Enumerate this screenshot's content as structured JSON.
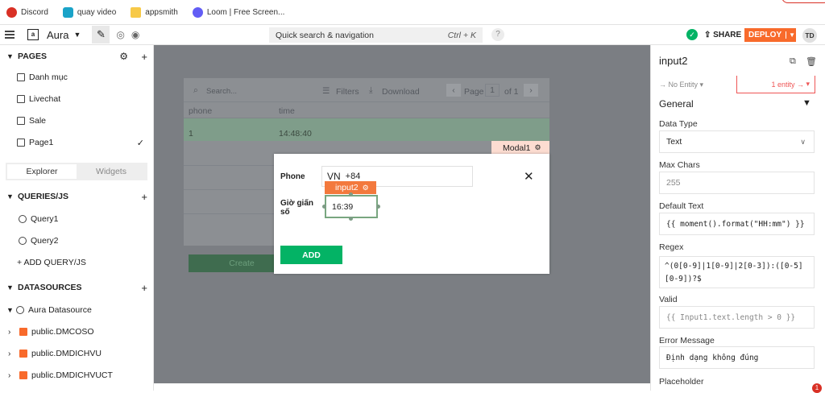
{
  "bookmarks": [
    {
      "label": "Discord",
      "color": "#d93025"
    },
    {
      "label": "quay video",
      "color": "#1aa3c8"
    },
    {
      "label": "appsmith",
      "color": "#f7c948"
    },
    {
      "label": "Loom | Free Screen...",
      "color": "#625df5"
    }
  ],
  "topbar": {
    "app_name": "Aura",
    "search_label": "Quick search & navigation",
    "search_shortcut": "Ctrl + K",
    "help": "?",
    "share": "SHARE",
    "deploy": "DEPLOY",
    "avatar": "TD"
  },
  "sidebar": {
    "pages_title": "PAGES",
    "pages": [
      "Danh mục",
      "Livechat",
      "Sale",
      "Page1"
    ],
    "tabs": [
      "Explorer",
      "Widgets"
    ],
    "queries_title": "QUERIES/JS",
    "queries": [
      "Query1",
      "Query2"
    ],
    "add_query": "+ ADD QUERY/JS",
    "datasources_title": "DATASOURCES",
    "datasources": [
      "Aura Datasource",
      "public.DMCOSO",
      "public.DMDICHVU",
      "public.DMDICHVUCT"
    ]
  },
  "table": {
    "search_placeholder": "Search...",
    "filters": "Filters",
    "download": "Download",
    "page_label": "Page",
    "page_num": "1",
    "page_of": "of 1",
    "columns": [
      "phone",
      "time"
    ],
    "rows": [
      [
        "1",
        "14:48:40"
      ]
    ],
    "create_label": "Create"
  },
  "modal": {
    "tag": "Modal1",
    "phone_label": "Phone",
    "phone_country": "VN",
    "phone_code": "+84",
    "time_label_1": "Giờ giấn",
    "time_label_2": "số",
    "input_tag": "input2",
    "time_value": "16:39",
    "add_label": "ADD"
  },
  "props": {
    "widget_name": "input2",
    "no_entity": "→ No Entity",
    "entity": "1 entity →",
    "section": "General",
    "data_type_label": "Data Type",
    "data_type_value": "Text",
    "max_chars_label": "Max Chars",
    "max_chars_value": "255",
    "default_text_label": "Default Text",
    "default_text_value": "{{ moment().format(\"HH:mm\") }}",
    "regex_label": "Regex",
    "regex_value": "^(0[0-9]|1[0-9]|2[0-3]):([0-5][0-9])?$",
    "valid_label": "Valid",
    "valid_value": "{{ Input1.text.length > 0 }}",
    "error_label": "Error Message",
    "error_value": "Định dạng không đúng",
    "placeholder_label": "Placeholder"
  },
  "notification_count": "1"
}
